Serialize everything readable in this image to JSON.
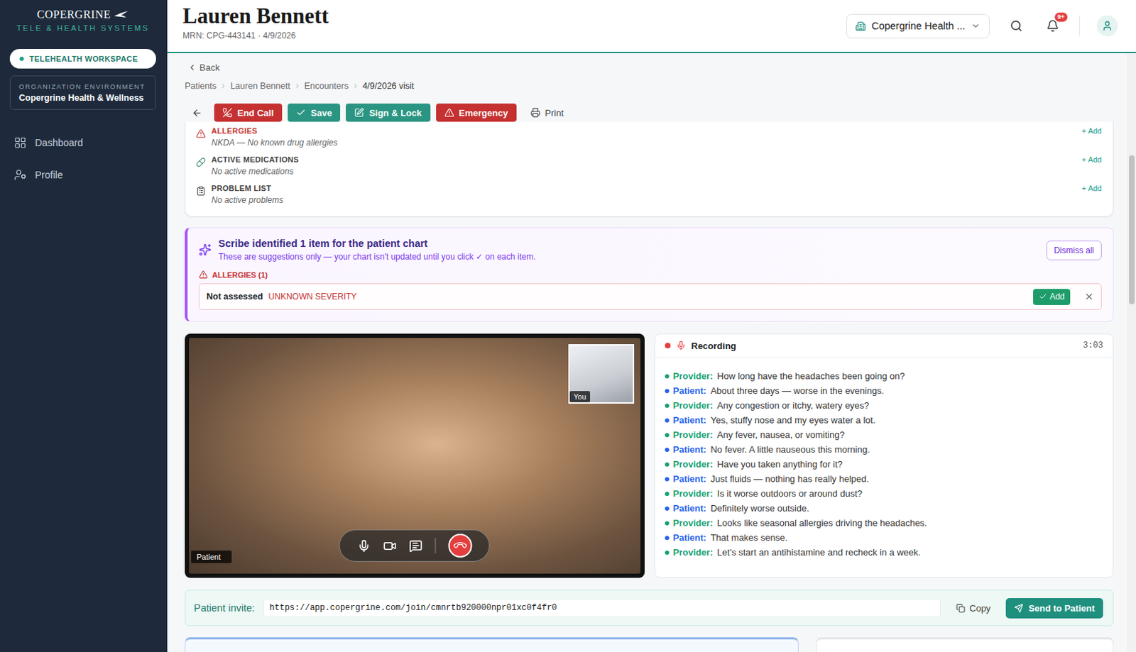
{
  "sidebar": {
    "logo": "COPERGRINE",
    "tagline": "TELE & HEALTH SYSTEMS",
    "workspace": "TELEHEALTH WORKSPACE",
    "org_label": "ORGANIZATION ENVIRONMENT",
    "org_name": "Copergrine Health & Wellness",
    "items": [
      {
        "label": "Dashboard",
        "selected": false
      },
      {
        "label": "Profile",
        "selected": false
      }
    ]
  },
  "header": {
    "name": "Lauren Bennett",
    "mrn": "MRN: CPG-443141 · 4/9/2026",
    "org_select": "Copergrine Health ...",
    "notifications": "9+"
  },
  "back": "Back",
  "breadcrumbs": [
    "Patients",
    "Lauren Bennett",
    "Encounters",
    "4/9/2026 visit"
  ],
  "toolbar": [
    {
      "label": "End Call",
      "kind": "danger"
    },
    {
      "label": "Save",
      "kind": "primary"
    },
    {
      "label": "Sign & Lock",
      "kind": "primary"
    },
    {
      "label": "Emergency",
      "kind": "danger"
    },
    {
      "label": "Print",
      "kind": "plain"
    }
  ],
  "chart_sections": [
    {
      "title": "ALLERGIES",
      "value": "NKDA — No known drug allergies",
      "action": "+ Add",
      "kind": "alert"
    },
    {
      "title": "ACTIVE MEDICATIONS",
      "value": "No active medications",
      "action": "+ Add",
      "kind": "normal"
    },
    {
      "title": "PROBLEM LIST",
      "value": "No active problems",
      "action": "+ Add",
      "kind": "normal"
    }
  ],
  "scribe": {
    "title": "Scribe identified 1 item for the patient chart",
    "subtitle": "These are suggestions only — your chart isn't updated until you click ✓ on each item.",
    "dismiss": "Dismiss all",
    "group": "ALLERGIES (1)",
    "items": [
      {
        "name": "Not assessed",
        "severity": "UNKNOWN SEVERITY",
        "add": "Add"
      }
    ]
  },
  "video": {
    "self_label": "You",
    "patient_label": "Patient"
  },
  "transcript": {
    "status": "Recording",
    "time": "3:03",
    "lines": [
      {
        "speaker": "Provider:",
        "text": "How long have the headaches been going on?",
        "color": "#16a070"
      },
      {
        "speaker": "Patient:",
        "text": "About three days — worse in the evenings.",
        "color": "#2563eb"
      },
      {
        "speaker": "Provider:",
        "text": "Any congestion or itchy, watery eyes?",
        "color": "#16a070"
      },
      {
        "speaker": "Patient:",
        "text": "Yes, stuffy nose and my eyes water a lot.",
        "color": "#2563eb"
      },
      {
        "speaker": "Provider:",
        "text": "Any fever, nausea, or vomiting?",
        "color": "#16a070"
      },
      {
        "speaker": "Patient:",
        "text": "No fever. A little nauseous this morning.",
        "color": "#2563eb"
      },
      {
        "speaker": "Provider:",
        "text": "Have you taken anything for it?",
        "color": "#16a070"
      },
      {
        "speaker": "Patient:",
        "text": "Just fluids — nothing has really helped.",
        "color": "#2563eb"
      },
      {
        "speaker": "Provider:",
        "text": "Is it worse outdoors or around dust?",
        "color": "#16a070"
      },
      {
        "speaker": "Patient:",
        "text": "Definitely worse outside.",
        "color": "#2563eb"
      },
      {
        "speaker": "Provider:",
        "text": "Looks like seasonal allergies driving the headaches.",
        "color": "#16a070"
      },
      {
        "speaker": "Patient:",
        "text": "That makes sense.",
        "color": "#2563eb"
      },
      {
        "speaker": "Provider:",
        "text": "Let's start an antihistamine and recheck in a week.",
        "color": "#16a070"
      }
    ]
  },
  "invite": {
    "label": "Patient invite:",
    "url": "https://app.copergrine.com/join/cmnrtb920000npr01xc0f4fr0",
    "copy": "Copy",
    "send": "Send to Patient"
  }
}
